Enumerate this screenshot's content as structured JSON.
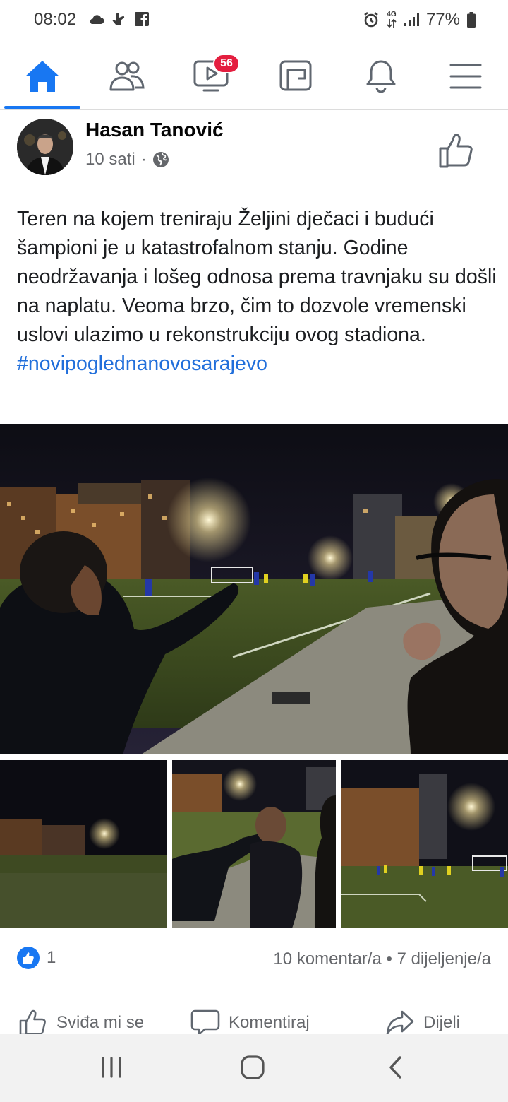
{
  "status_bar": {
    "time": "08:02",
    "left_icons": [
      "cloud-icon",
      "hand-icon",
      "facebook-icon"
    ],
    "right_icons": [
      "alarm-icon",
      "network-4g-icon",
      "signal-icon"
    ],
    "network_label": "4G",
    "battery_percent": "77%"
  },
  "top_nav": {
    "items": [
      {
        "name": "home-icon",
        "active": true
      },
      {
        "name": "friends-icon",
        "active": false
      },
      {
        "name": "watch-icon",
        "active": false,
        "badge": "56"
      },
      {
        "name": "groups-icon",
        "active": false
      },
      {
        "name": "notifications-icon",
        "active": false
      },
      {
        "name": "menu-icon",
        "active": false
      }
    ],
    "watch_badge": "56",
    "accent_color": "#1877f2",
    "badge_color": "#e41e3f"
  },
  "post": {
    "author": "Hasan Tanović",
    "time": "10 sati",
    "separator": "·",
    "privacy_icon": "globe-icon",
    "text": "Teren na kojem treniraju Željini dječaci i budući šampioni je u katastrofalnom stanju. Godine neodržavanja i lošeg odnosa prema travnjaku su došli na naplatu. Veoma brzo, čim to dozvole vremenski uslovi ulazimo u rekonstrukciju ovog stadiona.",
    "hashtag": "#novipoglednanovosarajevo",
    "hashtag_color": "#216fdb",
    "photo_count": 4
  },
  "reactions": {
    "like_count": "1",
    "comments": "10 komentar/a",
    "dot": "•",
    "shares": "7 dijeljenje/a"
  },
  "actions": {
    "like_label": "Sviđa mi se",
    "comment_label": "Komentiraj",
    "share_label": "Dijeli"
  },
  "android_nav": {
    "items": [
      "recents-icon",
      "home-button-icon",
      "back-icon"
    ]
  }
}
